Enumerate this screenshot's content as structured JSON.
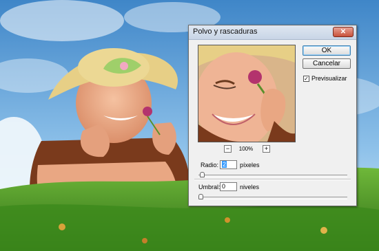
{
  "dialog": {
    "title": "Polvo y rascaduras",
    "close_icon": "close-icon",
    "ok_label": "OK",
    "cancel_label": "Cancelar",
    "preview_label": "Previsualizar",
    "preview_checked": true,
    "preview_check_glyph": "✓",
    "zoom_out_glyph": "−",
    "zoom_in_glyph": "+",
    "zoom_level": "100%",
    "radius": {
      "label": "Radio:",
      "value": "2",
      "unit": "píxeles",
      "slider_fraction": 0.01
    },
    "threshold": {
      "label": "Umbral:",
      "value": "0",
      "unit": "niveles",
      "slider_fraction": 0.0
    }
  },
  "colors": {
    "sky": "#5aa0d8",
    "grass": "#3e8a22",
    "hat": "#e7cf86",
    "skin": "#e9a783",
    "hair": "#7a3a1c",
    "accent": "#3399ff"
  }
}
